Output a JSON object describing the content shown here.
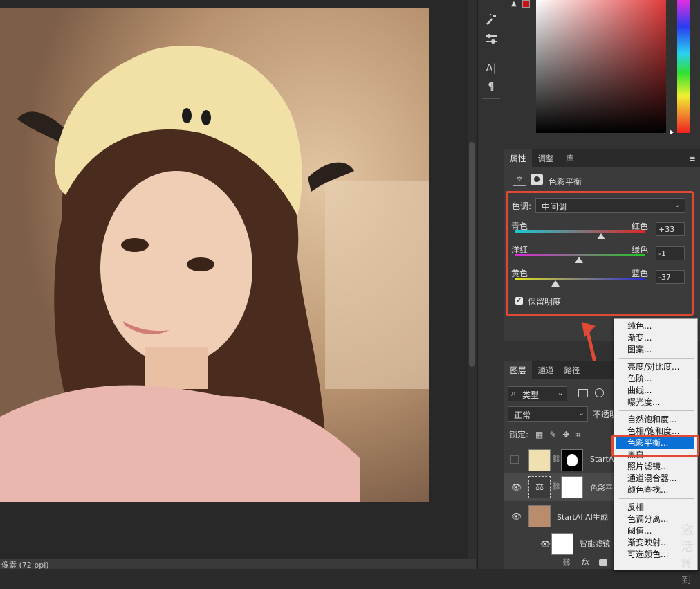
{
  "status_bar": {
    "text": "像素 (72 ppi)"
  },
  "toolbar": {
    "icons": [
      "brush-settings-icon",
      "sliders-icon",
      "character-icon",
      "paragraph-icon"
    ],
    "char_glyph": "A|",
    "para_glyph": "¶"
  },
  "colors": {
    "accent_red": "#e04a35",
    "menu_highlight": "#0a70d6",
    "fg_swatch": "#cc1111"
  },
  "properties": {
    "tabs": [
      "属性",
      "调整",
      "库"
    ],
    "title": "色彩平衡",
    "tone_label": "色调:",
    "tone_value": "中间调",
    "sliders": [
      {
        "left": "青色",
        "right": "红色",
        "value": "+33",
        "fraction": 0.66
      },
      {
        "left": "洋红",
        "right": "绿色",
        "value": "-1",
        "fraction": 0.49
      },
      {
        "left": "黄色",
        "right": "蓝色",
        "value": "-37",
        "fraction": 0.31
      }
    ],
    "preserve_label": "保留明度",
    "preserve_checked": true
  },
  "layers": {
    "tabs": [
      "图层",
      "通道",
      "路径"
    ],
    "filter_label": "类型",
    "blend_mode": "正常",
    "opacity_label": "不透明",
    "lock_label": "锁定:",
    "rows": [
      {
        "name": "StartAI",
        "visible": false
      },
      {
        "name": "色彩平",
        "visible": true
      },
      {
        "name": "StartAI AI生成",
        "visible": true
      },
      {
        "name": "智能滤镜",
        "visible": true
      }
    ],
    "fx_label": "fx"
  },
  "context_menu": {
    "groups": [
      [
        "纯色...",
        "渐变...",
        "图案..."
      ],
      [
        "亮度/对比度...",
        "色阶...",
        "曲线...",
        "曝光度..."
      ],
      [
        "自然饱和度...",
        "色相/饱和度...",
        "色彩平衡...",
        "黑白...",
        "照片滤镜...",
        "通道混合器...",
        "颜色查找..."
      ],
      [
        "反相",
        "色调分离...",
        "阈值...",
        "渐变映射...",
        "可选颜色..."
      ]
    ],
    "selected": "色彩平衡..."
  },
  "watermark": {
    "line1": "激活",
    "line2": "转到"
  }
}
